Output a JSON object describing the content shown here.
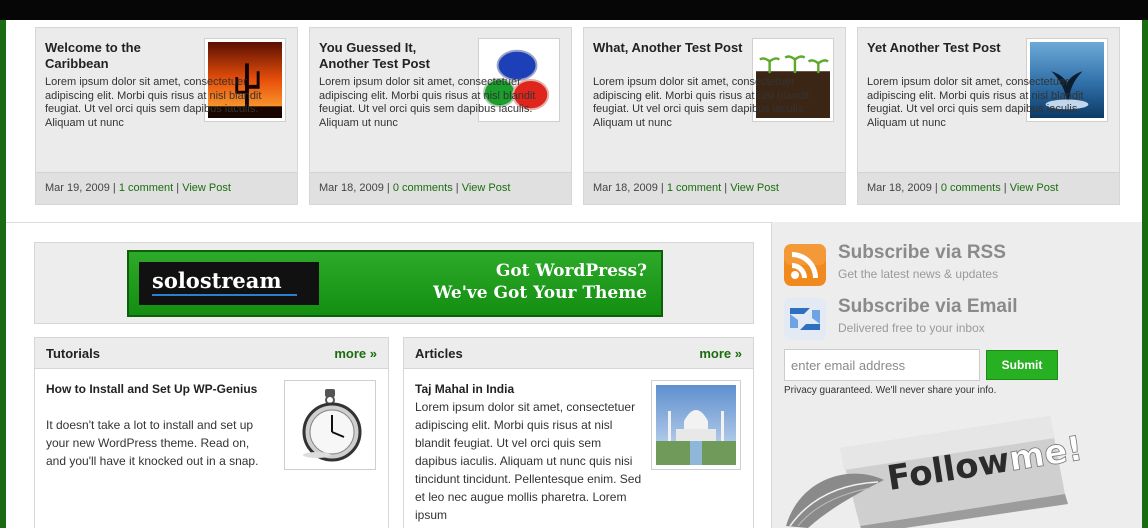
{
  "featured": [
    {
      "title": "Welcome to the Caribbean",
      "excerpt": "Lorem ipsum dolor sit amet, consectetuer adipiscing elit. Morbi quis risus at nisl blandit feugiat. Ut vel orci quis sem dapibus iaculis. Aliquam ut nunc",
      "date": "Mar 19, 2009",
      "comments": "1 comment",
      "view": "View Post"
    },
    {
      "title": "You Guessed It, Another Test Post",
      "excerpt": "Lorem ipsum dolor sit amet, consectetuer adipiscing elit. Morbi quis risus at nisl blandit feugiat. Ut vel orci quis sem dapibus iaculis. Aliquam ut nunc",
      "date": "Mar 18, 2009",
      "comments": "0 comments",
      "view": "View Post"
    },
    {
      "title": "What, Another Test Post",
      "excerpt": "Lorem ipsum dolor sit amet, consectetuer adipiscing elit. Morbi quis risus at nisl blandit feugiat. Ut vel orci quis sem dapibus iaculis. Aliquam ut nunc",
      "date": "Mar 18, 2009",
      "comments": "1 comment",
      "view": "View Post"
    },
    {
      "title": "Yet Another Test Post",
      "excerpt": "Lorem ipsum dolor sit amet, consectetuer adipiscing elit. Morbi quis risus at nisl blandit feugiat. Ut vel orci quis sem dapibus iaculis. Aliquam ut nunc",
      "date": "Mar 18, 2009",
      "comments": "0 comments",
      "view": "View Post"
    }
  ],
  "meta_separator": " | ",
  "banner": {
    "logo": "solostream",
    "line1": "Got WordPress?",
    "line2": "We've Got Your Theme"
  },
  "tutorials": {
    "heading": "Tutorials",
    "more": "more »",
    "entry_title": "How to Install and Set Up WP-Genius",
    "entry_body": "It doesn't take a lot to install and set up your new WordPress theme. Read on, and you'll have it knocked out in a snap."
  },
  "articles": {
    "heading": "Articles",
    "more": "more »",
    "entry_title": "Taj Mahal in India",
    "entry_body": "Lorem ipsum dolor sit amet, consectetuer adipiscing elit. Morbi quis risus at nisl blandit feugiat. Ut vel orci quis sem dapibus iaculis. Aliquam ut nunc quis nisi tincidunt tincidunt. Pellentesque enim. Sed et leo nec augue mollis pharetra. Lorem ipsum"
  },
  "sidebar": {
    "rss_title": "Subscribe via RSS",
    "rss_sub": "Get the latest news & updates",
    "email_title": "Subscribe via Email",
    "email_sub": "Delivered free to your inbox",
    "email_placeholder": "enter email address",
    "submit": "Submit",
    "privacy": "Privacy guaranteed. We'll never share your info.",
    "follow_a": "Follow",
    "follow_b": "me!"
  },
  "colors": {
    "brand_green": "#1a6b12",
    "link_green": "#1b6d0f",
    "rss_orange": "#f08a1e"
  }
}
